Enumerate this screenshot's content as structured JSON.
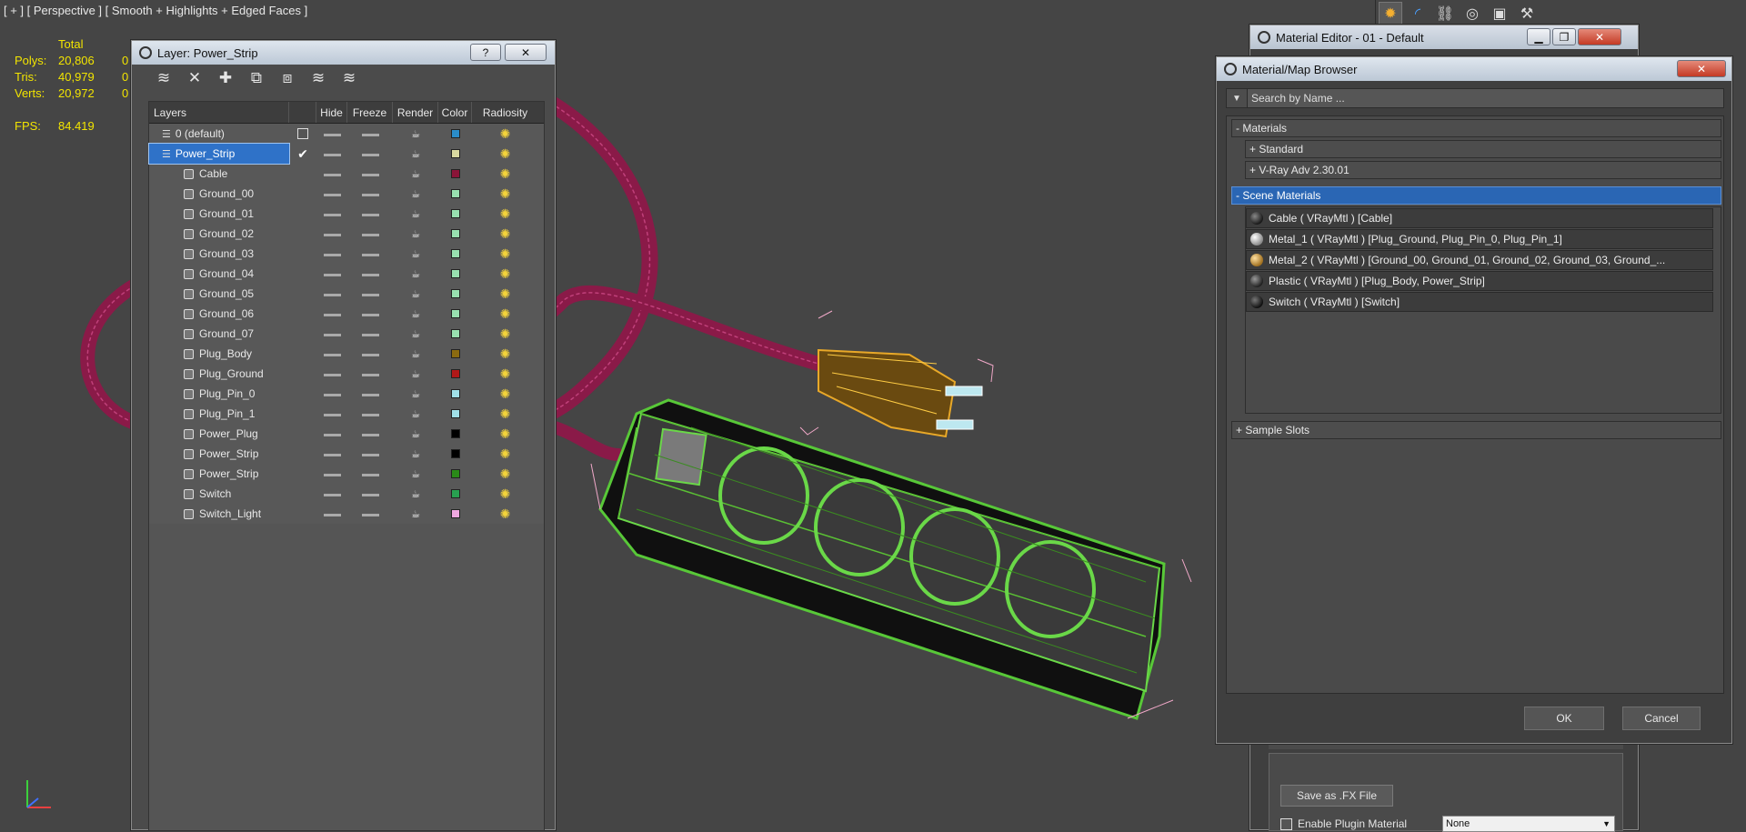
{
  "viewport": {
    "label": "[ + ] [ Perspective ] [ Smooth + Highlights + Edged Faces ]",
    "stats": {
      "header": "Total",
      "rows": [
        {
          "key": "Polys:",
          "v1": "20,806",
          "v2": "0"
        },
        {
          "key": "Tris:",
          "v1": "40,979",
          "v2": "0"
        },
        {
          "key": "Verts:",
          "v1": "20,972",
          "v2": "0"
        }
      ],
      "fps_key": "FPS:",
      "fps_value": "84.419"
    }
  },
  "command_panel": {
    "tabs": [
      "create-icon",
      "modify-icon",
      "hierarchy-icon",
      "motion-icon",
      "display-icon",
      "utilities-icon"
    ]
  },
  "layer_window": {
    "title": "Layer: Power_Strip",
    "help_btn": "?",
    "close_btn": "✕",
    "toolbar_icons": [
      "create-layer-icon",
      "delete-layer-icon",
      "add-to-layer-icon",
      "select-in-layer-icon",
      "highlight-selected-icon",
      "hide-all-icon",
      "freeze-all-icon"
    ],
    "columns": [
      "Layers",
      "Hide",
      "Freeze",
      "Render",
      "Color",
      "Radiosity"
    ],
    "rows": [
      {
        "name": "0 (default)",
        "type": "layer",
        "color": "#2a8cc8"
      },
      {
        "name": "Power_Strip",
        "type": "layer",
        "color": "#d8d8a0",
        "selected": true,
        "current": true
      },
      {
        "name": "Cable",
        "type": "object",
        "color": "#8a1438"
      },
      {
        "name": "Ground_00",
        "type": "object",
        "color": "#98e0b0"
      },
      {
        "name": "Ground_01",
        "type": "object",
        "color": "#98e0b0"
      },
      {
        "name": "Ground_02",
        "type": "object",
        "color": "#98e0b0"
      },
      {
        "name": "Ground_03",
        "type": "object",
        "color": "#98e0b0"
      },
      {
        "name": "Ground_04",
        "type": "object",
        "color": "#98e0b0"
      },
      {
        "name": "Ground_05",
        "type": "object",
        "color": "#98e0b0"
      },
      {
        "name": "Ground_06",
        "type": "object",
        "color": "#98e0b0"
      },
      {
        "name": "Ground_07",
        "type": "object",
        "color": "#98e0b0"
      },
      {
        "name": "Plug_Body",
        "type": "object",
        "color": "#8a6a10"
      },
      {
        "name": "Plug_Ground",
        "type": "object",
        "color": "#b01818"
      },
      {
        "name": "Plug_Pin_0",
        "type": "object",
        "color": "#a0e0e8"
      },
      {
        "name": "Plug_Pin_1",
        "type": "object",
        "color": "#a0e0e8"
      },
      {
        "name": "Power_Plug",
        "type": "object",
        "color": "#000000"
      },
      {
        "name": "Power_Strip",
        "type": "object",
        "color": "#000000"
      },
      {
        "name": "Power_Strip",
        "type": "object",
        "color": "#2a8a18"
      },
      {
        "name": "Switch",
        "type": "object",
        "color": "#28a050"
      },
      {
        "name": "Switch_Light",
        "type": "object",
        "color": "#f0a8e0"
      }
    ]
  },
  "material_editor": {
    "title": "Material Editor - 01 - Default",
    "minimize_btn": "▁",
    "restore_btn": "❐",
    "close_btn": "✕",
    "fx_button": "Save as .FX File",
    "plugin_label": "Enable Plugin Material",
    "plugin_value": "None"
  },
  "material_browser": {
    "title": "Material/Map Browser",
    "close_btn": "✕",
    "search_placeholder": "Search by Name ...",
    "groups": {
      "materials": "- Materials",
      "standard": "+ Standard",
      "vray": "+ V-Ray Adv 2.30.01",
      "scene_materials": "- Scene Materials",
      "sample_slots": "+ Sample Slots"
    },
    "scene_materials": [
      {
        "label": "Cable  ( VRayMtl ) [Cable]",
        "sphere": "#1a1a1a"
      },
      {
        "label": "Metal_1  ( VRayMtl ) [Plug_Ground, Plug_Pin_0, Plug_Pin_1]",
        "sphere": "#b8b8b8"
      },
      {
        "label": "Metal_2  ( VRayMtl ) [Ground_00, Ground_01, Ground_02, Ground_03, Ground_...",
        "sphere": "#c89838"
      },
      {
        "label": "Plastic  ( VRayMtl ) [Plug_Body, Power_Strip]",
        "sphere": "#222222"
      },
      {
        "label": "Switch  ( VRayMtl ) [Switch]",
        "sphere": "#111111"
      }
    ],
    "ok": "OK",
    "cancel": "Cancel"
  }
}
